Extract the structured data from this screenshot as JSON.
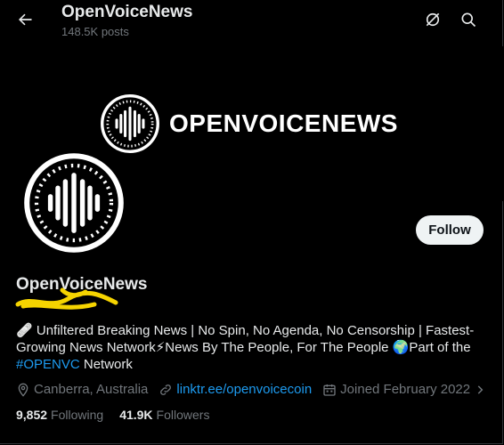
{
  "header": {
    "title": "OpenVoiceNews",
    "subtitle": "148.5K posts"
  },
  "banner": {
    "brand_text": "OPENVOICENEWS"
  },
  "profile": {
    "display_name": "OpenVoiceNews",
    "follow_label": "Follow",
    "bio": {
      "pin_emoji": "🩹",
      "line1": "Unfiltered Breaking News | No Spin, No Agenda, No Censorship | Fastest-",
      "line2a": "Growing News Network",
      "bolt_emoji": "⚡",
      "line2b": "News By The People, For The People",
      "globe_emoji": "🌍",
      "line2c": "Part of the",
      "hashtag": "#OPENVC",
      "line3": "Network"
    },
    "location": "Canberra, Australia",
    "link": "linktr.ee/openvoicecoin",
    "joined": "Joined February 2022",
    "following_count": "9,852",
    "following_label": "Following",
    "followers_count": "41.9K",
    "followers_label": "Followers"
  },
  "colors": {
    "background": "#000000",
    "text": "#e7e9ea",
    "muted": "#71767b",
    "link": "#1d9bf0",
    "follow_bg": "#eff3f4",
    "scribble": "#f5d400"
  },
  "icons": [
    "back-arrow-icon",
    "grok-icon",
    "search-icon",
    "location-icon",
    "link-icon",
    "calendar-icon",
    "chevron-right-icon"
  ]
}
